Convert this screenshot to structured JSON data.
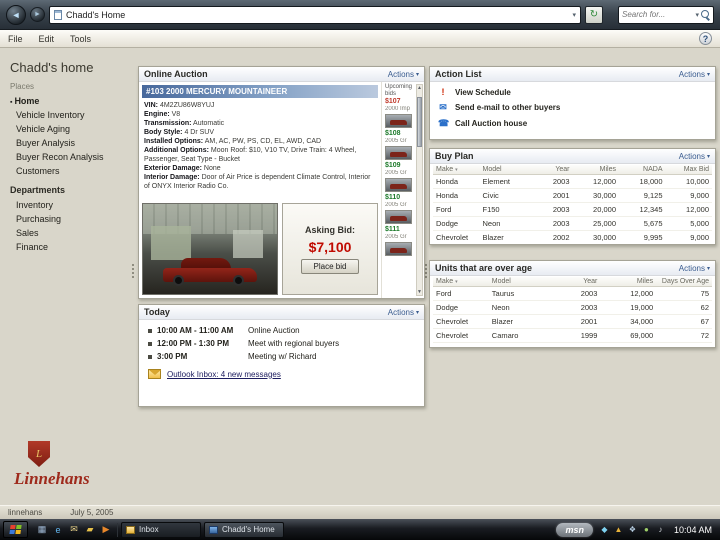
{
  "chrome": {
    "address_value": "Chadd's Home",
    "search_placeholder": "Search for...",
    "menu": [
      "File",
      "Edit",
      "Tools"
    ]
  },
  "sidebar": {
    "title": "Chadd's home",
    "sections": [
      {
        "label": "Places",
        "items": [
          "Home",
          "Vehicle Inventory",
          "Vehicle Aging",
          "Buyer Analysis",
          "Buyer Recon Analysis",
          "Customers"
        ]
      },
      {
        "label": "Departments",
        "items": [
          "Inventory",
          "Purchasing",
          "Sales",
          "Finance"
        ]
      }
    ],
    "logo_letter": "L",
    "logo_text": "Linnehans"
  },
  "statusbar": {
    "app": "linnehans",
    "date": "July 5, 2005"
  },
  "auction": {
    "title": "Online Auction",
    "actions_label": "Actions",
    "lot_title": "#103  2000 MERCURY MOUNTAINEER",
    "details": [
      {
        "label": "VIN:",
        "value": "4M2ZU86W8YUJ"
      },
      {
        "label": "Engine:",
        "value": "V8"
      },
      {
        "label": "Transmission:",
        "value": "Automatic"
      },
      {
        "label": "Body Style:",
        "value": "4 Dr SUV"
      },
      {
        "label": "Installed Options:",
        "value": "AM, AC, PW, PS, CD, EL, AWD, CAD"
      },
      {
        "label": "Additional Options:",
        "value": "Moon Roof: $10, V10 TV, Drive Train: 4 Wheel, Passenger, Seat Type - Bucket"
      },
      {
        "label": "Exterior Damage:",
        "value": "None"
      },
      {
        "label": "Interior Damage:",
        "value": "Door of Air Price is dependent Climate Control, Interior of ONYX Interior Radio Co."
      }
    ],
    "upcoming_label": "Upcoming bids",
    "upcoming": [
      {
        "price": "$107",
        "desc": "2000 Imp"
      },
      {
        "price": "$108",
        "desc": "2005 Gr"
      },
      {
        "price": "$109",
        "desc": "2005 Gr"
      },
      {
        "price": "$110",
        "desc": "2005 Gr"
      },
      {
        "price": "$111",
        "desc": "2005 Gr"
      }
    ],
    "asking_label": "Asking Bid:",
    "asking_value": "$7,100",
    "bid_button": "Place bid"
  },
  "action_list": {
    "title": "Action List",
    "actions_label": "Actions",
    "items": [
      {
        "icon": "exclamation-icon",
        "glyph": "!",
        "color": "#cc2200",
        "label": "View Schedule"
      },
      {
        "icon": "mail-icon",
        "glyph": "✉",
        "color": "#2a6fc9",
        "label": "Send e-mail to other buyers"
      },
      {
        "icon": "phone-icon",
        "glyph": "☎",
        "color": "#2a6fc9",
        "label": "Call Auction house"
      }
    ]
  },
  "buy_plan": {
    "title": "Buy Plan",
    "actions_label": "Actions",
    "headers": [
      "Make",
      "Model",
      "Year",
      "Miles",
      "NADA",
      "Max Bid"
    ],
    "rows": [
      [
        "Honda",
        "Element",
        "2003",
        "12,000",
        "18,000",
        "10,000"
      ],
      [
        "Honda",
        "Civic",
        "2001",
        "30,000",
        "9,125",
        "9,000"
      ],
      [
        "Ford",
        "F150",
        "2003",
        "20,000",
        "12,345",
        "12,000"
      ],
      [
        "Dodge",
        "Neon",
        "2003",
        "25,000",
        "5,675",
        "5,000"
      ],
      [
        "Chevrolet",
        "Blazer",
        "2002",
        "30,000",
        "9,995",
        "9,000"
      ]
    ]
  },
  "over_age": {
    "title": "Units that are over age",
    "actions_label": "Actions",
    "headers": [
      "Make",
      "Model",
      "Year",
      "Miles",
      "Days Over Age"
    ],
    "rows": [
      [
        "Ford",
        "Taurus",
        "2003",
        "12,000",
        "75"
      ],
      [
        "Dodge",
        "Neon",
        "2003",
        "19,000",
        "62"
      ],
      [
        "Chevrolet",
        "Blazer",
        "2001",
        "34,000",
        "67"
      ],
      [
        "Chevrolet",
        "Camaro",
        "1999",
        "69,000",
        "72"
      ]
    ]
  },
  "today": {
    "title": "Today",
    "actions_label": "Actions",
    "items": [
      {
        "time": "10:00 AM - 11:00 AM",
        "desc": "Online Auction"
      },
      {
        "time": "12:00 PM - 1:30 PM",
        "desc": "Meet with regional buyers"
      },
      {
        "time": "3:00 PM",
        "desc": "Meeting w/ Richard"
      }
    ],
    "inbox": "Outlook Inbox: 4 new messages"
  },
  "taskbar": {
    "quick_launch": [
      {
        "name": "show-desktop-icon",
        "glyph": "▦",
        "color": "#9fb8d4"
      },
      {
        "name": "ie-icon",
        "glyph": "e",
        "color": "#63b6ef"
      },
      {
        "name": "mail-icon",
        "glyph": "✉",
        "color": "#e8d28a"
      },
      {
        "name": "folder-icon",
        "glyph": "▰",
        "color": "#e8c24a"
      },
      {
        "name": "media-player-icon",
        "glyph": "▶",
        "color": "#e8872a"
      }
    ],
    "tasks": [
      {
        "label": "Inbox"
      },
      {
        "label": "Chadd's Home"
      }
    ],
    "msn_label": "msn",
    "tray": [
      {
        "name": "messenger-icon",
        "glyph": "◆",
        "color": "#7fd2f0"
      },
      {
        "name": "security-icon",
        "glyph": "▲",
        "color": "#e8b23a"
      },
      {
        "name": "network-icon",
        "glyph": "❖",
        "color": "#bcd3e8"
      },
      {
        "name": "update-icon",
        "glyph": "●",
        "color": "#9fd06a"
      },
      {
        "name": "volume-icon",
        "glyph": "♪",
        "color": "#d8dde2"
      }
    ],
    "time": "10:04 AM"
  }
}
